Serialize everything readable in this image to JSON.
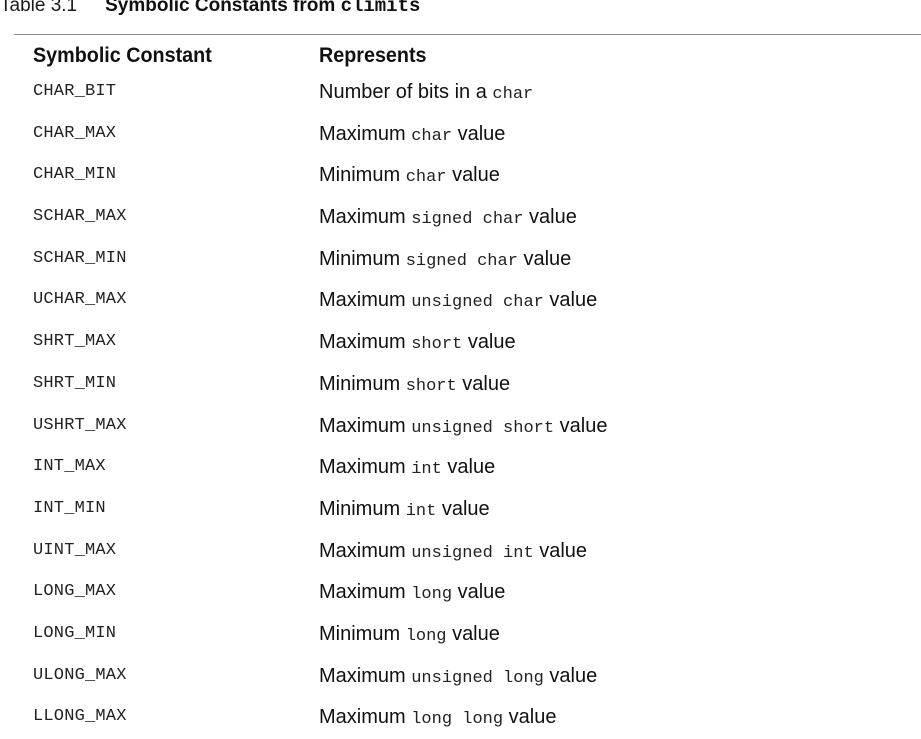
{
  "caption": {
    "label": "Table 3.1",
    "title_text": "Symbolic Constants from",
    "title_code": "climits"
  },
  "table": {
    "headers": [
      "Symbolic Constant",
      "Represents"
    ],
    "rows": [
      {
        "constant": "CHAR_BIT",
        "lead": "Number of bits in a",
        "code": "char",
        "tail": ""
      },
      {
        "constant": "CHAR_MAX",
        "lead": "Maximum",
        "code": "char",
        "tail": "value"
      },
      {
        "constant": "CHAR_MIN",
        "lead": "Minimum",
        "code": "char",
        "tail": "value"
      },
      {
        "constant": "SCHAR_MAX",
        "lead": "Maximum",
        "code": "signed char",
        "tail": "value"
      },
      {
        "constant": "SCHAR_MIN",
        "lead": "Minimum",
        "code": "signed char",
        "tail": "value"
      },
      {
        "constant": "UCHAR_MAX",
        "lead": "Maximum",
        "code": "unsigned char",
        "tail": "value"
      },
      {
        "constant": "SHRT_MAX",
        "lead": "Maximum",
        "code": "short",
        "tail": "value"
      },
      {
        "constant": "SHRT_MIN",
        "lead": "Minimum",
        "code": "short",
        "tail": "value"
      },
      {
        "constant": "USHRT_MAX",
        "lead": "Maximum",
        "code": "unsigned short",
        "tail": "value"
      },
      {
        "constant": "INT_MAX",
        "lead": "Maximum",
        "code": "int",
        "tail": "value"
      },
      {
        "constant": "INT_MIN",
        "lead": "Minimum",
        "code": "int",
        "tail": "value"
      },
      {
        "constant": "UINT_MAX",
        "lead": "Maximum",
        "code": "unsigned int",
        "tail": "value"
      },
      {
        "constant": "LONG_MAX",
        "lead": "Maximum",
        "code": "long",
        "tail": "value"
      },
      {
        "constant": "LONG_MIN",
        "lead": "Minimum",
        "code": "long",
        "tail": "value"
      },
      {
        "constant": "ULONG_MAX",
        "lead": "Maximum",
        "code": "unsigned long",
        "tail": "value"
      },
      {
        "constant": "LLONG_MAX",
        "lead": "Maximum",
        "code": "long long",
        "tail": "value"
      }
    ]
  }
}
